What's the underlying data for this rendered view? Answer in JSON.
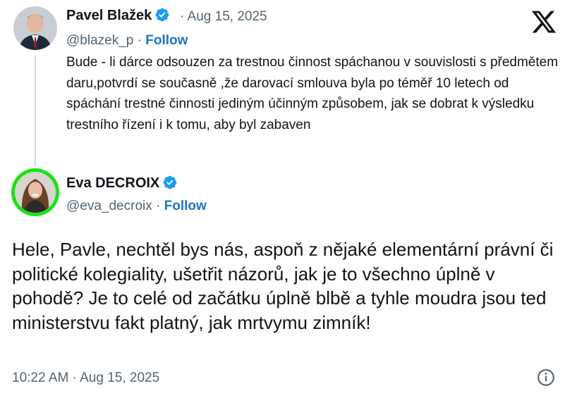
{
  "parent": {
    "name": "Pavel Blažek",
    "time": "· Aug 15, 2025",
    "handle": "@blazek_p",
    "separator": "·",
    "follow": "Follow",
    "text": "Bude - li dárce odsouzen za trestnou činnost spáchanou v souvislosti s předmětem daru,potvrdí  se současně ,že darovací smlouva byla po téměř 10 letech od spáchání trestné činnosti jediným účinným způsobem, jak se dobrat k výsledku trestního řízení i k tomu, aby byl zabaven"
  },
  "reply": {
    "name": "Eva DECROIX",
    "handle": "@eva_decroix",
    "separator": "·",
    "follow": "Follow",
    "text": "Hele, Pavle, nechtěl bys nás, aspoň z nějaké elementární právní či politické kolegiality, ušetřit názorů, jak je to všechno úplně v pohodě? Je to celé od začátku úplně blbě a tyhle moudra jsou ted ministerstvu fakt platný, jak mrtvymu zimník!",
    "timestamp": "10:22 AM · Aug 15, 2025"
  },
  "colors": {
    "verified": "#1d9bf0",
    "follow": "#1d76c2",
    "secondary_text": "#536471",
    "avatar_ring": "#19e314"
  },
  "icons": {
    "brand": "x-logo-icon",
    "verified": "verified-badge-icon",
    "info": "info-icon"
  }
}
